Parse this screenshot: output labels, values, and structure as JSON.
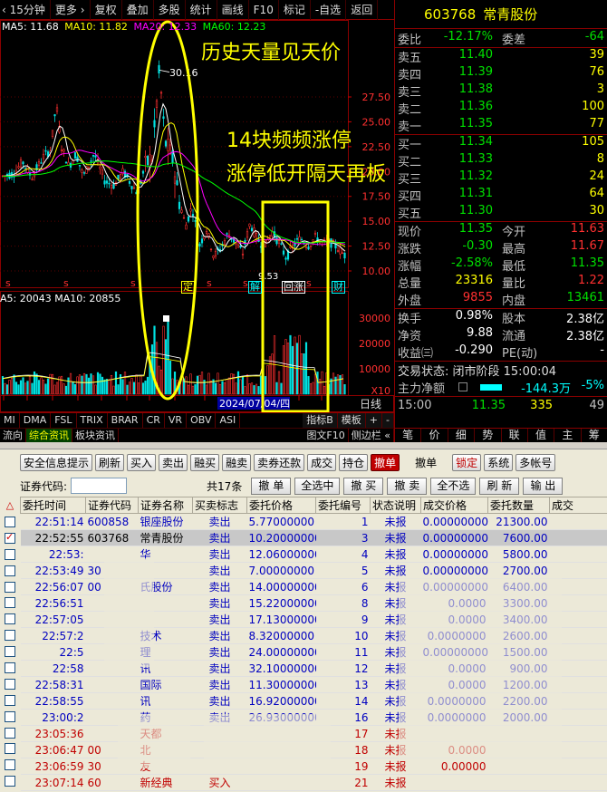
{
  "toolbar": {
    "period": "15分钟",
    "more": "更多",
    "items": [
      "复权",
      "叠加",
      "多股",
      "统计",
      "画线",
      "F10",
      "标记",
      "-自选",
      "返回"
    ]
  },
  "ma_legend": {
    "ma5": "MA5: 11.68",
    "ma10": "MA10: 11.82",
    "ma20": "MA20: 12.33",
    "ma60": "MA60: 12.23"
  },
  "price_axis": [
    "27.50",
    "25.00",
    "22.50",
    "20.00",
    "17.50",
    "15.00",
    "12.50",
    "10.00"
  ],
  "vol_axis": [
    "30000",
    "20000",
    "10000",
    "X10"
  ],
  "peak_label": "30.16",
  "low_label": "9.53",
  "vol_legend": "A5: 20043 MA10: 20855",
  "date_label": "2024/07/04/四",
  "axis_corner": "日线",
  "chart_tags": [
    "定",
    "解",
    "回涨",
    "财"
  ],
  "annotations": {
    "a1": "历史天量见天价",
    "a2": "14块频频涨停",
    "a3": "涨停低开隔天再板"
  },
  "indicator_tabs": [
    "MI",
    "DMA",
    "FSL",
    "TRIX",
    "BRAR",
    "CR",
    "VR",
    "OBV",
    "ASI"
  ],
  "indicator_tabs_right": [
    "指标B",
    "模板",
    "+",
    "-"
  ],
  "indicator_tabs2": [
    "流向",
    "综合资讯",
    "板块资讯"
  ],
  "indicator_tabs2_right": [
    "图文F10",
    "侧边栏 «"
  ],
  "quote": {
    "code": "603768",
    "name": "常青股份",
    "weibi_label": "委比",
    "weibi": "-12.17%",
    "weicha_label": "委差",
    "weicha": "-64",
    "asks": [
      {
        "label": "卖五",
        "price": "11.40",
        "vol": "39"
      },
      {
        "label": "卖四",
        "price": "11.39",
        "vol": "76"
      },
      {
        "label": "卖三",
        "price": "11.38",
        "vol": "3"
      },
      {
        "label": "卖二",
        "price": "11.36",
        "vol": "100"
      },
      {
        "label": "卖一",
        "price": "11.35",
        "vol": "77"
      }
    ],
    "bids": [
      {
        "label": "买一",
        "price": "11.34",
        "vol": "105"
      },
      {
        "label": "买二",
        "price": "11.33",
        "vol": "8"
      },
      {
        "label": "买三",
        "price": "11.32",
        "vol": "24"
      },
      {
        "label": "买四",
        "price": "11.31",
        "vol": "64"
      },
      {
        "label": "买五",
        "price": "11.30",
        "vol": "30"
      }
    ],
    "stats": [
      {
        "l1": "现价",
        "v1": "11.35",
        "c1": "green",
        "l2": "今开",
        "v2": "11.63",
        "c2": "red"
      },
      {
        "l1": "涨跌",
        "v1": "-0.30",
        "c1": "green",
        "l2": "最高",
        "v2": "11.67",
        "c2": "red"
      },
      {
        "l1": "涨幅",
        "v1": "-2.58%",
        "c1": "green",
        "l2": "最低",
        "v2": "11.35",
        "c2": "green"
      },
      {
        "l1": "总量",
        "v1": "23316",
        "c1": "yellow",
        "l2": "量比",
        "v2": "1.22",
        "c2": "red"
      },
      {
        "l1": "外盘",
        "v1": "9855",
        "c1": "red",
        "l2": "内盘",
        "v2": "13461",
        "c2": "green"
      }
    ],
    "stats2": [
      {
        "l1": "换手",
        "v1": "0.98%",
        "l2": "股本",
        "v2": "2.38亿"
      },
      {
        "l1": "净资",
        "v1": "9.88",
        "l2": "流通",
        "v2": "2.38亿"
      },
      {
        "l1": "收益㈢",
        "v1": "-0.290",
        "l2": "PE(动)",
        "v2": "-"
      }
    ],
    "trade_status": "交易状态: 闭市阶段 15:00:04",
    "main_force_label": "主力净额",
    "main_force": "-144.3万",
    "main_force_pct": "-5%",
    "tick_time": "15:00",
    "tick_price": "11.35",
    "tick_vol": "335",
    "tick_bs": "49",
    "bottom_tabs": [
      "笔",
      "价",
      "细",
      "势",
      "联",
      "值",
      "主",
      "筹"
    ]
  },
  "trade": {
    "toolbar": [
      "安全信息提示",
      "刷新",
      "买入",
      "卖出",
      "融买",
      "融卖",
      "卖券还款",
      "成交",
      "持仓",
      "撤单"
    ],
    "toolbar_active": "撤单",
    "toolbar_title": "撤单",
    "toolbar_right": [
      "锁定",
      "系统",
      "多帐号"
    ],
    "code_label": "证券代码:",
    "count": "共17条",
    "buttons": [
      "撤 单",
      "全选中",
      "撤 买",
      "撤 卖",
      "全不选",
      "刷 新",
      "输 出"
    ],
    "columns": [
      "委托时间",
      "证券代码",
      "证券名称",
      "买卖标志",
      "委托价格",
      "委托编号",
      "状态说明",
      "成交价格",
      "委托数量",
      "成交"
    ],
    "rows": [
      {
        "time": "22:51:14",
        "code": "600858",
        "name": "银座股份",
        "side": "卖出",
        "price": "5.77000000",
        "no": "1",
        "status": "未报",
        "deal": "0.00000000",
        "qty": "21300.00",
        "color": "blue"
      },
      {
        "time": "22:52:55",
        "code": "603768",
        "name": "常青股份",
        "side": "卖出",
        "price": "10.20000000",
        "no": "3",
        "status": "未报",
        "deal": "0.00000000",
        "qty": "7600.00",
        "color": "blue",
        "selected": true
      },
      {
        "time": "22:53:",
        "code": "",
        "name": "华",
        "side": "卖出",
        "price": "12.06000000",
        "no": "4",
        "status": "未报",
        "deal": "0.00000000",
        "qty": "5800.00",
        "color": "blue"
      },
      {
        "time": "22:53:49",
        "code": "30",
        "name": "",
        "side": "卖出",
        "price": "7.00000000",
        "no": "5",
        "status": "未报",
        "deal": "0.00000000",
        "qty": "2700.00",
        "color": "blue"
      },
      {
        "time": "22:56:07",
        "code": "00",
        "name": "氏股份",
        "side": "卖出",
        "price": "14.00000000",
        "no": "6",
        "status": "未报",
        "deal": "0.00000000",
        "qty": "6400.00",
        "color": "blue"
      },
      {
        "time": "22:56:51",
        "code": "",
        "name": "",
        "side": "卖出",
        "price": "15.22000000",
        "no": "8",
        "status": "未报",
        "deal": "0.0000",
        "qty": "3300.00",
        "color": "blue"
      },
      {
        "time": "22:57:05",
        "code": "",
        "name": "",
        "side": "卖出",
        "price": "17.13000000",
        "no": "9",
        "status": "未报",
        "deal": "0.0000",
        "qty": "3400.00",
        "color": "blue"
      },
      {
        "time": "22:57:2",
        "code": "",
        "name": "技术",
        "side": "卖出",
        "price": "8.32000000",
        "no": "10",
        "status": "未报",
        "deal": "0.0000000",
        "qty": "2600.00",
        "color": "blue"
      },
      {
        "time": "22:5",
        "code": "",
        "name": "理",
        "side": "卖出",
        "price": "24.00000000",
        "no": "11",
        "status": "未报",
        "deal": "0.00000000",
        "qty": "1500.00",
        "color": "blue"
      },
      {
        "time": "22:58",
        "code": "",
        "name": "讯",
        "side": "卖出",
        "price": "32.10000000",
        "no": "12",
        "status": "未报",
        "deal": "0.0000",
        "qty": "900.00",
        "color": "blue"
      },
      {
        "time": "22:58:31",
        "code": "",
        "name": "国际",
        "side": "卖出",
        "price": "11.30000000",
        "no": "13",
        "status": "未报",
        "deal": "0.0000",
        "qty": "1200.00",
        "color": "blue"
      },
      {
        "time": "22:58:55",
        "code": "",
        "name": "讯",
        "side": "卖出",
        "price": "16.92000000",
        "no": "14",
        "status": "未报",
        "deal": "0.0000000",
        "qty": "2200.00",
        "color": "blue"
      },
      {
        "time": "23:00:2",
        "code": "",
        "name": "药",
        "side": "卖出",
        "price": "26.93000000",
        "no": "16",
        "status": "未报",
        "deal": "0.0000000",
        "qty": "2000.00",
        "color": "blue"
      },
      {
        "time": "23:05:36",
        "code": "",
        "name": "天都",
        "side": "",
        "price": "",
        "no": "17",
        "status": "未报",
        "deal": "",
        "qty": "",
        "color": "red"
      },
      {
        "time": "23:06:47",
        "code": "00",
        "name": "北",
        "side": "",
        "price": "",
        "no": "18",
        "status": "未报",
        "deal": "0.0000",
        "qty": "",
        "color": "red"
      },
      {
        "time": "23:06:59",
        "code": "30",
        "name": "友",
        "side": "",
        "price": "",
        "no": "19",
        "status": "未报",
        "deal": "0.00000",
        "qty": "",
        "color": "red"
      },
      {
        "time": "23:07:14",
        "code": "60",
        "name": "新经典",
        "side": "买入",
        "price": "",
        "no": "21",
        "status": "未报",
        "deal": "",
        "qty": "",
        "color": "red"
      }
    ]
  },
  "colors": {
    "up": "#ff3030",
    "down": "#00e000",
    "ma5": "#ffffff",
    "ma10": "#ffff00",
    "ma20": "#ff00ff",
    "ma60": "#00ff00",
    "annotation": "#ffff00"
  }
}
